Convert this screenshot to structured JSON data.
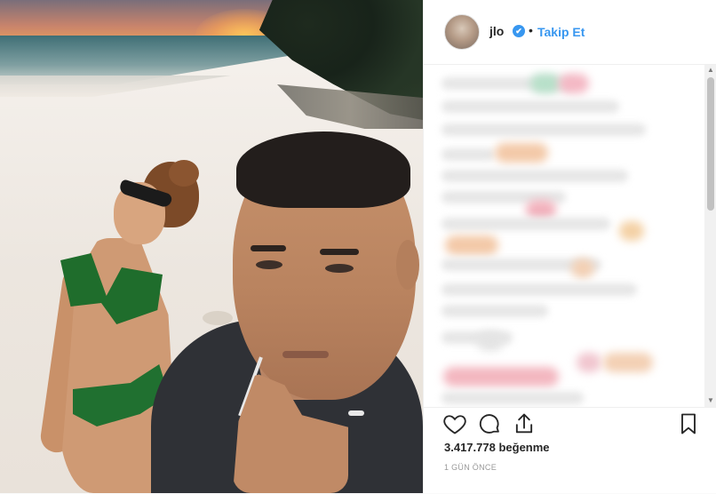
{
  "post": {
    "username": "jlo",
    "verified_mark": "✔",
    "separator": "•",
    "follow_label": "Takip Et",
    "likes_count": "3.417.778",
    "likes_label": "beğenme",
    "time_ago": "1 GÜN ÖNCE"
  },
  "icons": {
    "like": "heart-icon",
    "comment": "comment-icon",
    "share": "share-icon",
    "save": "bookmark-icon",
    "verified": "verified-badge-icon"
  },
  "colors": {
    "link": "#3897f0",
    "text": "#262626",
    "muted": "#999999",
    "border": "#efefef"
  }
}
